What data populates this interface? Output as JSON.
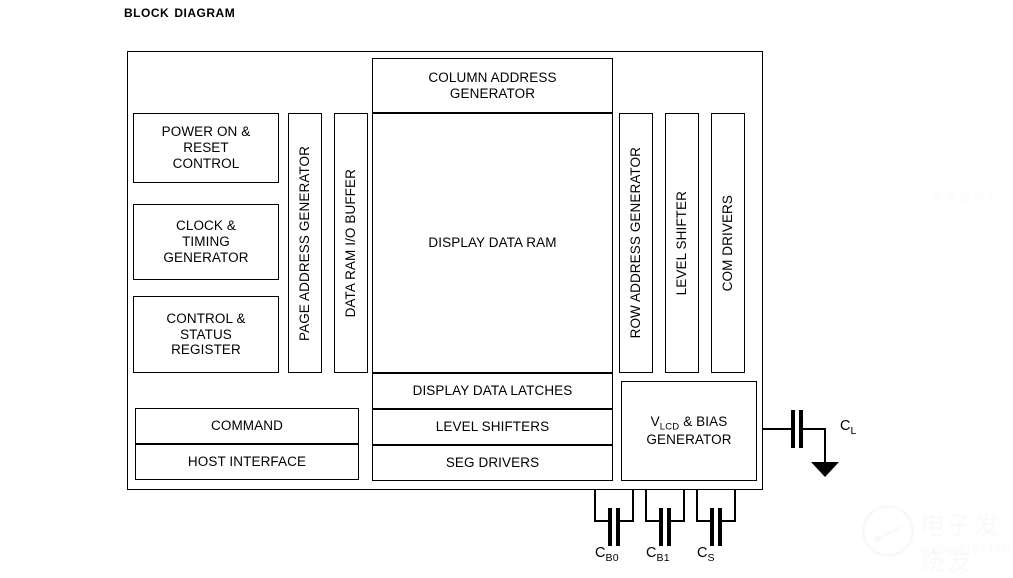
{
  "page": {
    "title": "Block Diagram"
  },
  "diagram": {
    "left_column": [
      {
        "label": "POWER ON &\nRESET\nCONTROL",
        "name": "power-on-reset-control"
      },
      {
        "label": "CLOCK &\nTIMING\nGENERATOR",
        "name": "clock-timing-generator"
      },
      {
        "label": "CONTROL &\nSTATUS\nREGISTER",
        "name": "control-status-register"
      }
    ],
    "vertical_left": [
      {
        "label": "PAGE ADDRESS GENERATOR",
        "name": "page-address-generator"
      },
      {
        "label": "DATA RAM I/O BUFFER",
        "name": "data-ram-io-buffer"
      }
    ],
    "center_column": [
      {
        "label": "COLUMN ADDRESS\nGENERATOR",
        "name": "column-address-generator"
      },
      {
        "label": "DISPLAY DATA RAM",
        "name": "display-data-ram"
      },
      {
        "label": "DISPLAY DATA LATCHES",
        "name": "display-data-latches"
      },
      {
        "label": "LEVEL SHIFTERS",
        "name": "level-shifters"
      },
      {
        "label": "SEG DRIVERS",
        "name": "seg-drivers"
      }
    ],
    "vertical_right": [
      {
        "label": "ROW ADDRESS GENERATOR",
        "name": "row-address-generator"
      },
      {
        "label": "LEVEL SHIFTER",
        "name": "level-shifter"
      },
      {
        "label": "COM DRIVERS",
        "name": "com-drivers"
      }
    ],
    "bottom_left": [
      {
        "label": "COMMAND",
        "name": "command"
      },
      {
        "label": "HOST INTERFACE",
        "name": "host-interface"
      }
    ],
    "bias_block": {
      "line1_main": "V",
      "line1_sub": "LCD",
      "line1_rest": " & BIAS",
      "line2": "GENERATOR"
    },
    "capacitors": [
      {
        "main": "C",
        "sub": "B0",
        "name": "capacitor-cb0"
      },
      {
        "main": "C",
        "sub": "B1",
        "name": "capacitor-cb1"
      },
      {
        "main": "C",
        "sub": "S",
        "name": "capacitor-cs"
      },
      {
        "main": "C",
        "sub": "L",
        "name": "capacitor-cl"
      }
    ]
  },
  "watermark": {
    "chinese": "电子发烧友",
    "url": "www.elecfans.com",
    "chinese_small": "电子发烧友"
  }
}
